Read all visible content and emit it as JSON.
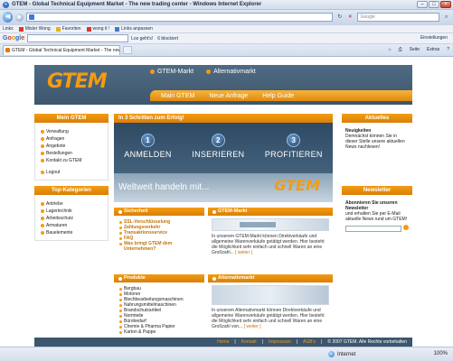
{
  "browser": {
    "title": "GTEM - Global Technical Equipment Market - The new trading center - Windows Internet Explorer",
    "url": "",
    "search_placeholder": "Google",
    "links_label": "Links",
    "favorites": [
      "Mister Wong",
      "Favoriten",
      "wong it !",
      "Links anpassen"
    ],
    "google_logo": "Google",
    "google_tools": [
      "Los geht's!",
      "6 blockiert"
    ],
    "google_settings": "Einstellungen",
    "tab_title": "GTEM - Global Technical Equipment Market - The new ...",
    "commands": [
      "Seite",
      "Extras"
    ],
    "status_zone": "Internet",
    "zoom": "100%"
  },
  "site": {
    "logo": "GTEM",
    "header_links": [
      "GTEM-Markt",
      "Alternativmarkt"
    ],
    "nav": [
      "Main GTEM",
      "Neue Anfrage",
      "Help Guide"
    ],
    "left_box": {
      "title": "Mein GTEM",
      "items": [
        "Verwaltung",
        "Anfragen",
        "Angebote",
        "Bestellungen",
        "Kontakt zu GTEM"
      ],
      "logout": "Logout"
    },
    "categories": {
      "title": "Top-Kategorien",
      "items": [
        "Antriebe",
        "Lagertechnik",
        "Arbeitsschutz",
        "Armaturen",
        "Bauelemente"
      ]
    },
    "banner": {
      "head": "In 3 Schritten zum Erfolg!",
      "steps": [
        {
          "num": "1",
          "label": "ANMELDEN"
        },
        {
          "num": "2",
          "label": "INSERIEREN"
        },
        {
          "num": "3",
          "label": "PROFITIEREN"
        }
      ],
      "slogan": "Weltweit handeln mit...",
      "logo": "GTEM"
    },
    "security": {
      "title": "Sicherheit",
      "items": [
        "SSL-Verschlüsselung",
        "Zahlungsverkehr",
        "Transaktionsservice",
        "FAQ",
        "Was bringt GTEM dem Unternehmen?"
      ]
    },
    "market": {
      "title": "GTEM-Markt",
      "text": "In unserem GTEM-Markt können Direktverkäufe und allgemeine Warenverkäufe getätigt werden. Hier besteht die Möglichkeit sehr einfach und schnell Waren an eine Großzahl...",
      "more": "[ weiter ]"
    },
    "products": {
      "title": "Produkte",
      "items": [
        "Bergbau",
        "Motoren",
        "Blechbearbeitungsmaschinen",
        "Nahrungsmittelmaschinen",
        "Brandschutzartikel",
        "Normteile",
        "Bürobedarf",
        "Chemie & Pharma Papier",
        "Karton & Pappe"
      ]
    },
    "alternative": {
      "title": "Alternativmarkt",
      "text": "In unserem Alternativmarkt können Direktverkäufe und allgemeine Warenverkäufe getätigt werden. Hier besteht die Möglichkeit sehr einfach und schnell Waren an eine Großzahl von...",
      "more": "[ weiter ]"
    },
    "news": {
      "title": "Aktuelles",
      "heading": "Neuigkeiten",
      "text": "Demnächst können Sie in dieser Stelle unsere aktuellen News nachlesen!"
    },
    "newsletter": {
      "title": "Newsletter",
      "heading": "Abonnieren Sie unseren Newsletter",
      "text": "und erhalten Sie per E-Mail aktuelle News rund um GTEM!"
    },
    "footer": {
      "links": [
        "Home",
        "Kontakt",
        "Impressum",
        "AGB's"
      ],
      "copyright": "© 2007 GTEM. Alle Rechte vorbehalten"
    }
  }
}
